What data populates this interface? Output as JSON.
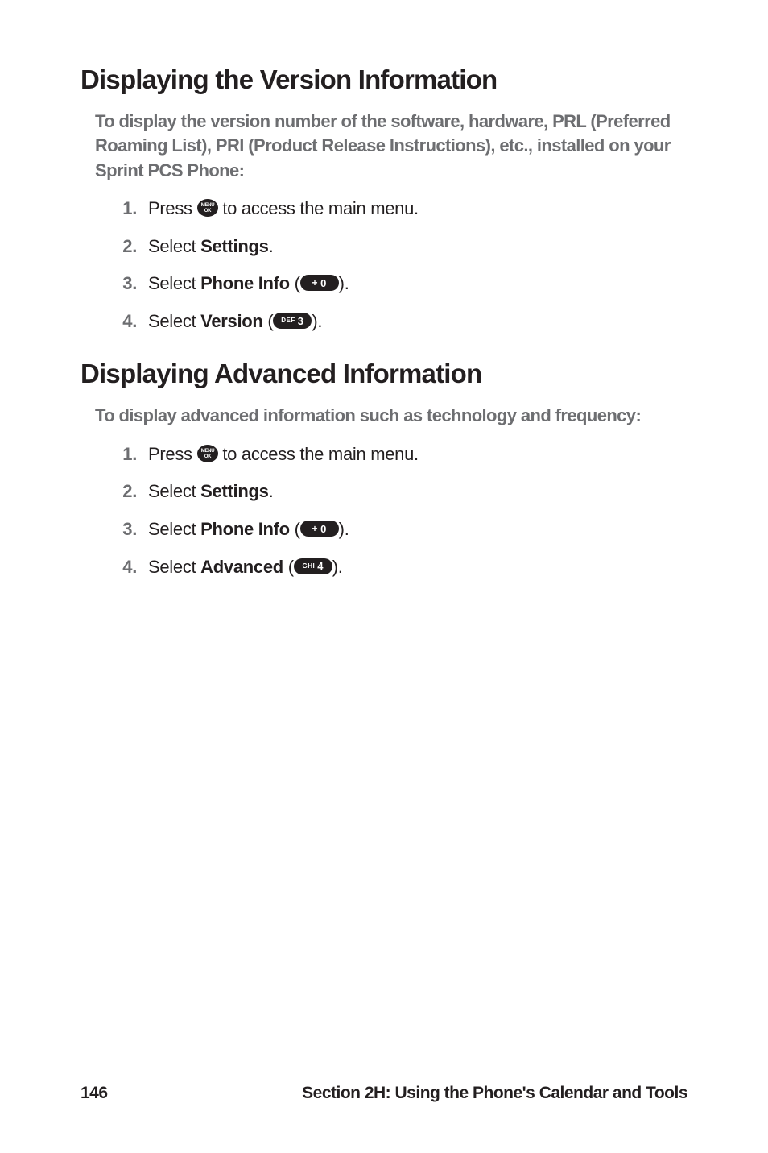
{
  "sections": [
    {
      "heading": "Displaying the Version Information",
      "intro": "To display the version number of the software, hardware, PRL (Preferred Roaming List), PRI (Product Release Instructions), etc., installed on your Sprint PCS Phone:",
      "steps": [
        {
          "prefix": "Press ",
          "icon": "menu",
          "suffix": " to access the main menu."
        },
        {
          "prefix": "Select ",
          "bold": "Settings",
          "suffix": "."
        },
        {
          "prefix": "Select ",
          "bold": "Phone Info",
          "suffix_open": " (",
          "key": {
            "pref": "+",
            "num": "0"
          },
          "suffix_close": ")."
        },
        {
          "prefix": "Select ",
          "bold": "Version",
          "suffix_open": " (",
          "key": {
            "pref": "DEF",
            "num": "3"
          },
          "suffix_close": ")."
        }
      ]
    },
    {
      "heading": "Displaying Advanced Information",
      "intro": "To display advanced information such as technology and frequency:",
      "steps": [
        {
          "prefix": "Press ",
          "icon": "menu",
          "suffix": " to access the main menu."
        },
        {
          "prefix": "Select ",
          "bold": "Settings",
          "suffix": "."
        },
        {
          "prefix": "Select ",
          "bold": "Phone Info",
          "suffix_open": " (",
          "key": {
            "pref": "+",
            "num": "0"
          },
          "suffix_close": ")."
        },
        {
          "prefix": "Select ",
          "bold": "Advanced",
          "suffix_open": " (",
          "key": {
            "pref": "GHI",
            "num": "4"
          },
          "suffix_close": ")."
        }
      ]
    }
  ],
  "footer": {
    "page": "146",
    "section": "Section 2H: Using the Phone's Calendar and Tools"
  },
  "icons": {
    "menu_top": "MENU",
    "menu_bottom": "OK"
  }
}
